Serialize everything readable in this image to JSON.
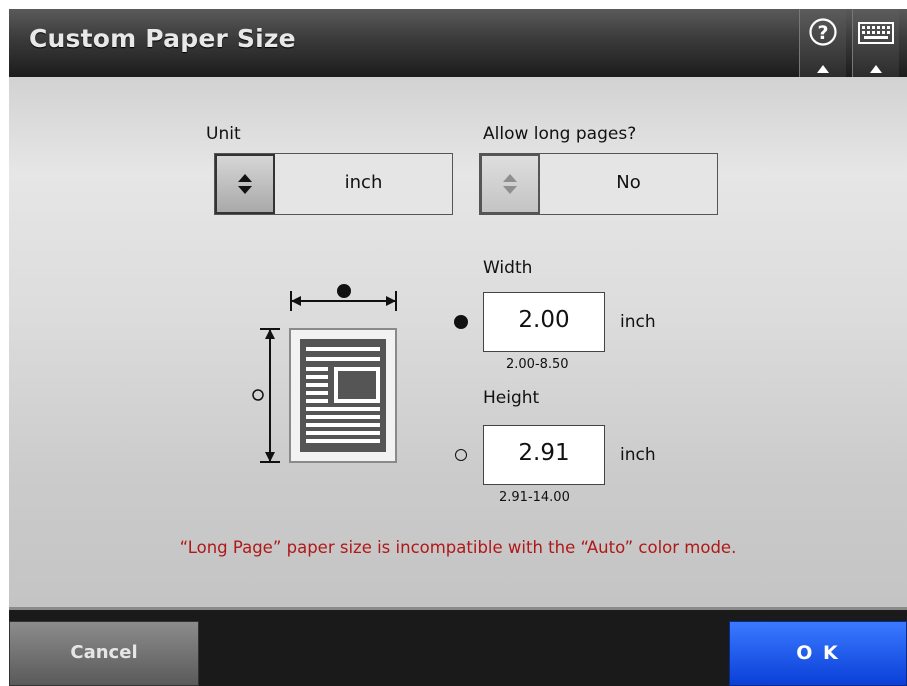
{
  "header": {
    "title": "Custom Paper Size",
    "help_icon": "help-icon",
    "keyboard_icon": "keyboard-icon"
  },
  "unit": {
    "label": "Unit",
    "value": "inch"
  },
  "long_pages": {
    "label": "Allow long pages?",
    "value": "No"
  },
  "width": {
    "label": "Width",
    "value": "2.00",
    "unit": "inch",
    "range": "2.00-8.50"
  },
  "height": {
    "label": "Height",
    "value": "2.91",
    "unit": "inch",
    "range": "2.91-14.00"
  },
  "warning": "“Long Page” paper size is incompatible with the “Auto” color mode.",
  "footer": {
    "cancel_label": "Cancel",
    "ok_label": "O K"
  },
  "colors": {
    "warning": "#b01818",
    "ok_button": "#1a55f0",
    "title_bar": "#2c2c2c"
  }
}
